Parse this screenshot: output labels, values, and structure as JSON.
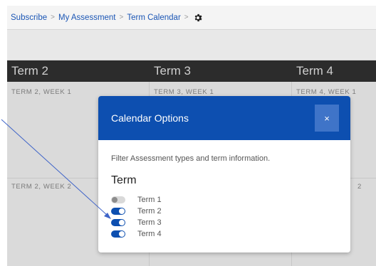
{
  "breadcrumb": {
    "items": [
      "Subscribe",
      "My Assessment",
      "Term Calendar"
    ],
    "separator": ">",
    "settings_icon": "gear-icon"
  },
  "calendar": {
    "terms": [
      "Term 2",
      "Term 3",
      "Term 4"
    ],
    "week_labels": [
      "TERM 2, WEEK 1",
      "TERM 3, WEEK 1",
      "TERM 4, WEEK 1"
    ],
    "week2_labels": [
      "TERM 2, WEEK 2",
      "2"
    ]
  },
  "modal": {
    "title": "Calendar Options",
    "close_label": "×",
    "description": "Filter Assessment types and term information.",
    "section_title": "Term",
    "terms": [
      {
        "label": "Term 1",
        "enabled": false
      },
      {
        "label": "Term 2",
        "enabled": true
      },
      {
        "label": "Term 3",
        "enabled": true
      },
      {
        "label": "Term 4",
        "enabled": true
      }
    ]
  },
  "colors": {
    "brand_blue": "#0d4fb0",
    "link_blue": "#1b56b5",
    "close_button": "#3f74c8",
    "arrow": "#3f64c8"
  }
}
